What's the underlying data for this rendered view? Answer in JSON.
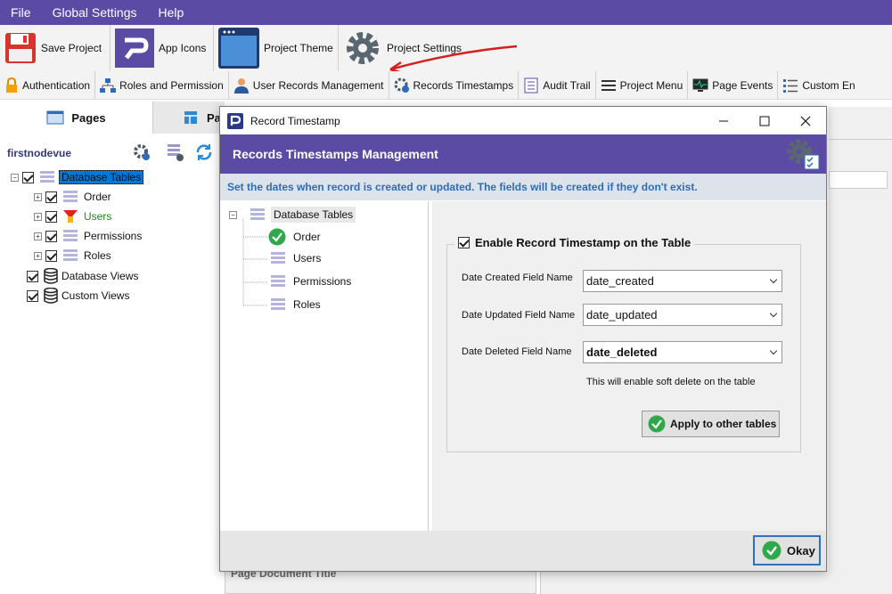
{
  "menubar": {
    "file": "File",
    "global_settings": "Global Settings",
    "help": "Help"
  },
  "toolbar1": {
    "save_project": "Save Project",
    "app_icons": "App Icons",
    "project_theme": "Project Theme",
    "project_settings": "Project Settings"
  },
  "toolbar2": {
    "authentication": "Authentication",
    "roles_permission": "Roles and Permission",
    "user_records": "User Records Management",
    "records_timestamps": "Records Timestamps",
    "audit_trail": "Audit Trail",
    "project_menu": "Project Menu",
    "page_events": "Page Events",
    "custom_en": "Custom En"
  },
  "left_panel": {
    "tab_pages": "Pages",
    "tab_other": "Pa",
    "project_name": "firstnodevue",
    "tree": {
      "database_tables": "Database Tables",
      "order": "Order",
      "users": "Users",
      "permissions": "Permissions",
      "roles": "Roles",
      "database_views": "Database Views",
      "custom_views": "Custom Views"
    }
  },
  "background": {
    "page_document_title": "Page Document Title"
  },
  "dialog": {
    "title": "Record Timestamp",
    "header": "Records Timestamps Management",
    "info": "Set the dates when record is created or updated. The fields will be created if they don't exist.",
    "tree": {
      "database_tables": "Database Tables",
      "order": "Order",
      "users": "Users",
      "permissions": "Permissions",
      "roles": "Roles"
    },
    "enable_label": "Enable Record Timestamp on the Table",
    "date_created_label": "Date Created Field Name",
    "date_created_value": "date_created",
    "date_updated_label": "Date Updated Field Name",
    "date_updated_value": "date_updated",
    "date_deleted_label": "Date Deleted Field Name",
    "date_deleted_value": "date_deleted",
    "soft_delete_hint": "This will enable soft delete on the table",
    "apply_button": "Apply to other tables",
    "okay_button": "Okay"
  },
  "colors": {
    "accent": "#5b4ba5",
    "info_text": "#2b6dba",
    "check_green": "#2ea84a",
    "users_green": "#1a8a1a",
    "selected": "#0078d7"
  }
}
